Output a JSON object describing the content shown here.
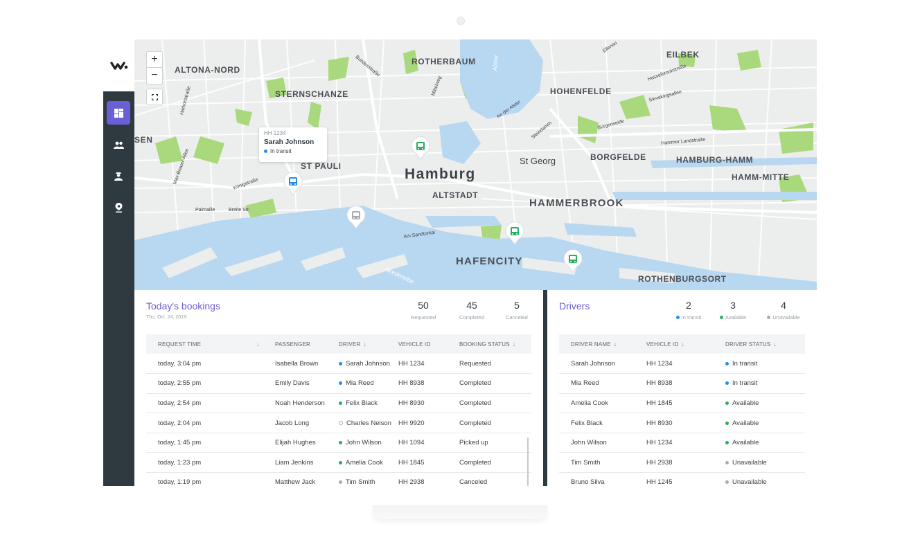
{
  "nav": {
    "items": [
      {
        "name": "dashboard",
        "active": true
      },
      {
        "name": "passengers",
        "active": false
      },
      {
        "name": "drivers",
        "active": false
      },
      {
        "name": "locations",
        "active": false
      }
    ]
  },
  "map": {
    "labels": [
      {
        "text": "ALTONA-NORD",
        "cls": "dist"
      },
      {
        "text": "STERNSCHANZE",
        "cls": "dist"
      },
      {
        "text": "ROTHERBAUM",
        "cls": "dist"
      },
      {
        "text": "HOHENFELDE",
        "cls": "dist"
      },
      {
        "text": "EILBEK",
        "cls": "dist"
      },
      {
        "text": "SEN",
        "cls": "dist"
      },
      {
        "text": "ST PAULI",
        "cls": "dist"
      },
      {
        "text": "Hamburg",
        "cls": "city"
      },
      {
        "text": "ALTSTADT",
        "cls": "dist"
      },
      {
        "text": "St Georg",
        "cls": "sub"
      },
      {
        "text": "BORGFELDE",
        "cls": "dist"
      },
      {
        "text": "HAMBURG-HAMM",
        "cls": "dist"
      },
      {
        "text": "HAMM-MITTE",
        "cls": "dist"
      },
      {
        "text": "HAMMERBROOK",
        "cls": "big"
      },
      {
        "text": "HAFENCITY",
        "cls": "big"
      },
      {
        "text": "ROTHENBURGSORT",
        "cls": "dist"
      },
      {
        "text": "Palmaille",
        "cls": "street"
      },
      {
        "text": "Breite Str.",
        "cls": "street"
      },
      {
        "text": "Königstraße",
        "cls": "street"
      },
      {
        "text": "Am Sandtorkai",
        "cls": "street"
      },
      {
        "text": "Hammer Landstraße",
        "cls": "street"
      },
      {
        "text": "Bürgerweide",
        "cls": "street"
      },
      {
        "text": "Sievekingsallee",
        "cls": "street"
      },
      {
        "text": "Hasselbrookstraße",
        "cls": "street"
      },
      {
        "text": "Harkortstraße",
        "cls": "street"
      },
      {
        "text": "Max-Brauer-Allee",
        "cls": "street"
      },
      {
        "text": "Bundesstraße",
        "cls": "street"
      },
      {
        "text": "Mittelweg",
        "cls": "street"
      },
      {
        "text": "An der Alster",
        "cls": "street"
      },
      {
        "text": "Steindamm",
        "cls": "street"
      },
      {
        "text": "Ellenau",
        "cls": "street"
      },
      {
        "text": "Norderelbe",
        "cls": "water"
      },
      {
        "text": "Alster",
        "cls": "water"
      }
    ],
    "zoom_in_label": "+",
    "zoom_out_label": "−",
    "popup": {
      "vehicle_id": "HH 1234",
      "driver": "Sarah Johnson",
      "status": "In transit"
    }
  },
  "bookings": {
    "title": "Today's bookings",
    "date": "Thu, Oct. 24, 2019",
    "stats": [
      {
        "value": "50",
        "label": "Requested"
      },
      {
        "value": "45",
        "label": "Completed"
      },
      {
        "value": "5",
        "label": "Canceled"
      }
    ],
    "columns": [
      "REQUEST TIME",
      "PASSENGER",
      "DRIVER",
      "VEHICLE ID",
      "BOOKING STATUS"
    ],
    "rows": [
      {
        "time": "today, 3:04 pm",
        "passenger": "Isabella Brown",
        "driver": "Sarah Johnson",
        "driver_status": "blue",
        "vehicle": "HH 1234",
        "status": "Requested"
      },
      {
        "time": "today, 2:55 pm",
        "passenger": "Emily Davis",
        "driver": "Mia Reed",
        "driver_status": "blue",
        "vehicle": "HH 8938",
        "status": "Completed"
      },
      {
        "time": "today, 2:54 pm",
        "passenger": "Noah Henderson",
        "driver": "Felix Black",
        "driver_status": "green",
        "vehicle": "HH 8930",
        "status": "Completed"
      },
      {
        "time": "today, 2:04 pm",
        "passenger": "Jacob Long",
        "driver": "Charles Nelson",
        "driver_status": "hollow",
        "vehicle": "HH 9920",
        "status": "Completed"
      },
      {
        "time": "today, 1:45 pm",
        "passenger": "Elijah Hughes",
        "driver": "John Wilson",
        "driver_status": "green",
        "vehicle": "HH 1094",
        "status": "Picked up"
      },
      {
        "time": "today, 1:23 pm",
        "passenger": "Liam Jenkins",
        "driver": "Amelia Cook",
        "driver_status": "green",
        "vehicle": "HH 1845",
        "status": "Completed"
      },
      {
        "time": "today, 1:19 pm",
        "passenger": "Matthew Jack",
        "driver": "Tim Smith",
        "driver_status": "grey",
        "vehicle": "HH 2938",
        "status": "Canceled"
      }
    ]
  },
  "drivers": {
    "title": "Drivers",
    "stats": [
      {
        "value": "2",
        "label": "In transit",
        "color": "blue"
      },
      {
        "value": "3",
        "label": "Available",
        "color": "green"
      },
      {
        "value": "4",
        "label": "Unavailable",
        "color": "grey"
      }
    ],
    "columns": [
      "DRIVER NAME",
      "VEHICLE ID",
      "DRIVER STATUS"
    ],
    "rows": [
      {
        "name": "Sarah Johnson",
        "vehicle": "HH 1234",
        "status": "In transit",
        "color": "blue"
      },
      {
        "name": "Mia Reed",
        "vehicle": "HH 8938",
        "status": "In transit",
        "color": "blue"
      },
      {
        "name": "Amelia Cook",
        "vehicle": "HH 1845",
        "status": "Available",
        "color": "green"
      },
      {
        "name": "Felix Black",
        "vehicle": "HH 8930",
        "status": "Available",
        "color": "green"
      },
      {
        "name": "John Wilson",
        "vehicle": "HH 1234",
        "status": "Available",
        "color": "green"
      },
      {
        "name": "Tim Smith",
        "vehicle": "HH 2938",
        "status": "Unavailable",
        "color": "grey"
      },
      {
        "name": "Bruno Silva",
        "vehicle": "HH 1245",
        "status": "Unavailable",
        "color": "grey"
      }
    ]
  },
  "colors": {
    "accent": "#6b5fd6",
    "sidebar": "#2f3a40",
    "in_transit": "#1f8ef1",
    "available": "#27ae60",
    "unavailable": "#a6abb0",
    "water": "#b8d7f0",
    "park": "#a9d97c"
  }
}
